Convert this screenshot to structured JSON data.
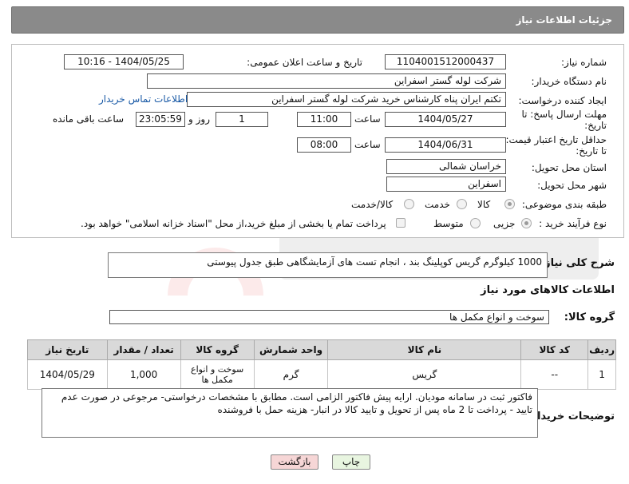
{
  "header": {
    "title": "جزئیات اطلاعات نیاز"
  },
  "form": {
    "need_number_label": "شماره نیاز:",
    "need_number": "1104001512000437",
    "announce_label": "تاریخ و ساعت اعلان عمومی:",
    "announce_value": "1404/05/25 - 10:16",
    "buyer_org_label": "نام دستگاه خریدار:",
    "buyer_org": "شرکت لوله گستر اسفراین",
    "creator_label": "ایجاد کننده درخواست:",
    "creator": "تکتم ایران پناه کارشناس خرید شرکت لوله گستر اسفراین",
    "contact_link": "اطلاعات تماس خریدار",
    "deadline_label_1": "مهلت ارسال پاسخ: تا",
    "deadline_label_2": "تاریخ:",
    "deadline_date": "1404/05/27",
    "time_label": "ساعت",
    "deadline_time": "11:00",
    "days_value": "1",
    "days_label": "روز و",
    "remaining_time": "23:05:59",
    "remaining_label": "ساعت باقی مانده",
    "price_validity_label_1": "حداقل تاریخ اعتبار قیمت:",
    "price_validity_label_2": "تا تاریخ:",
    "validity_date": "1404/06/31",
    "validity_time_label": "ساعت",
    "validity_time": "08:00",
    "province_label": "استان محل تحویل:",
    "province": "خراسان شمالی",
    "city_label": "شهر محل تحویل:",
    "city": "اسفراین",
    "category_label": "طبقه بندی موضوعی:",
    "category_options": [
      "کالا",
      "خدمت",
      "کالا/خدمت"
    ],
    "category_selected": "کالا",
    "process_label": "نوع فرآیند خرید :",
    "process_options": [
      "جزیی",
      "متوسط"
    ],
    "process_selected": "جزیی",
    "payment_note": "پرداخت تمام یا بخشی از مبلغ خرید،از محل \"اسناد خزانه اسلامی\" خواهد بود."
  },
  "description": {
    "label": "شرح کلی نیاز:",
    "text": "1000 کیلوگرم گریس کوپلینگ بند ، انجام تست های آزمایشگاهی طبق جدول پیوستی"
  },
  "goods_section": {
    "title": "اطلاعات کالاهای مورد نیاز",
    "group_label": "گروه کالا:",
    "group_value": "سوخت و انواع مکمل ها"
  },
  "table": {
    "headers": [
      "ردیف",
      "کد کالا",
      "نام کالا",
      "واحد شمارش",
      "گروه کالا",
      "تعداد / مقدار",
      "تاریخ نیاز"
    ],
    "rows": [
      [
        "1",
        "--",
        "گریس",
        "گرم",
        "سوخت و انواع مکمل ها",
        "1,000",
        "1404/05/29"
      ]
    ]
  },
  "buyer_notes": {
    "label": "توضیحات خریدار:",
    "text": "فاکتور ثبت در سامانه مودیان. ارایه پیش فاکتور الزامی است. مطابق با مشخصات درخواستی- مرجوعی در صورت عدم تایید - پرداخت تا 2 ماه پس از تحویل و تایید کالا در انبار- هزینه حمل با فروشنده"
  },
  "buttons": {
    "print": "چاپ",
    "back": "بازگشت"
  },
  "colors": {
    "header_bg": "#8a8a8a",
    "link": "#1a5aa6",
    "back_button": "#f6d6d6",
    "print_button": "#e8f5e0"
  }
}
